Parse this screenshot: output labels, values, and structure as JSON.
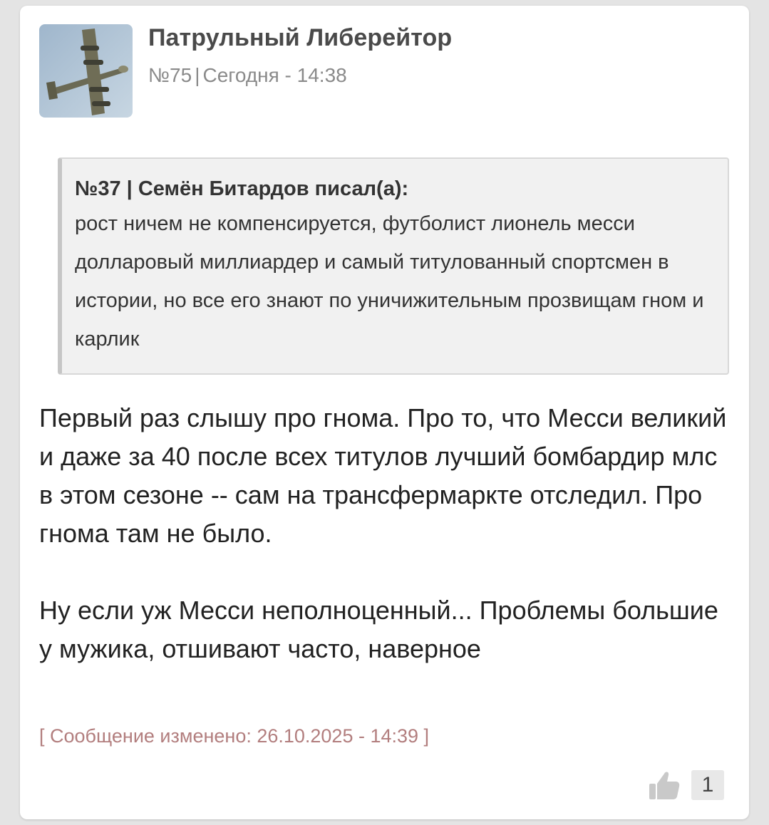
{
  "post": {
    "author": "Патрульный Либерейтор",
    "number": "№75",
    "separator": "|",
    "timestamp": "Сегодня - 14:38",
    "quote": {
      "header": "№37 | Семён Битардов писал(а):",
      "text": "рост ничем не компенсируется, футболист лионель месси долларовый миллиардер и самый титулованный спортсмен в истории, но все его знают по уничижительным прозвищам гном и карлик"
    },
    "paragraphs": [
      "Первый раз слышу про гнома. Про то, что Месси великий и даже за 40 после всех титулов лучший бомбардир млс в этом сезоне -- сам на трансфермаркте отследил. Про гнома там не было.",
      "Ну если уж Месси неполноценный... Проблемы большие у мужика, отшивают часто, наверное"
    ],
    "edited_note": "[ Сообщение изменено: 26.10.2025 - 14:39 ]",
    "likes": {
      "icon": "thumbs-up-icon",
      "count": "1"
    }
  },
  "colors": {
    "background": "#e4e4e4",
    "card": "#ffffff",
    "quote_background": "#f1f1f1",
    "edited_note": "#b27e7e",
    "meta": "#8a8a8a"
  }
}
